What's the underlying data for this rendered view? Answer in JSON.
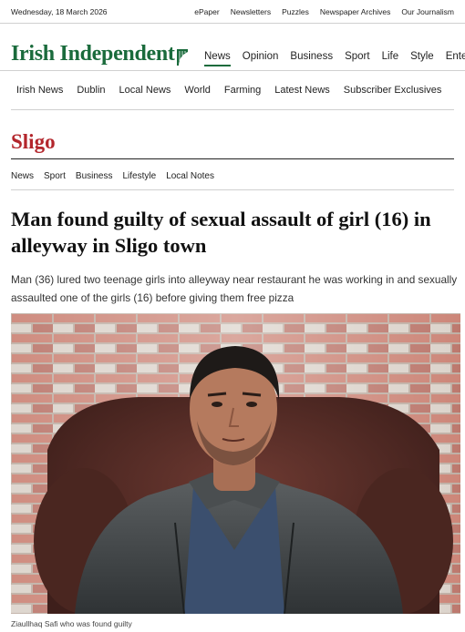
{
  "topbar": {
    "date": "Wednesday, 18 March 2026",
    "links": [
      "ePaper",
      "Newsletters",
      "Puzzles",
      "Newspaper Archives",
      "Our Journalism"
    ]
  },
  "masthead": {
    "logo": "Irish Independent",
    "brand_color": "#1a6b3c",
    "main_nav": [
      "News",
      "Opinion",
      "Business",
      "Sport",
      "Life",
      "Style",
      "Enter"
    ],
    "active_nav": "News"
  },
  "sub_nav": [
    "Irish News",
    "Dublin",
    "Local News",
    "World",
    "Farming",
    "Latest News",
    "Subscriber Exclusives"
  ],
  "section": {
    "title": "Sligo",
    "color": "#b3262c",
    "nav": [
      "News",
      "Sport",
      "Business",
      "Lifestyle",
      "Local Notes"
    ]
  },
  "article": {
    "headline": "Man found guilty of sexual assault of girl (16) in alleyway in Sligo town",
    "standfirst": "Man (36) lured two teenage girls into alleyway near restaurant he was working in and sexually assaulted one of the girls (16) before giving them free pizza",
    "image_caption": "Ziaullhaq Safi who was found guilty"
  }
}
